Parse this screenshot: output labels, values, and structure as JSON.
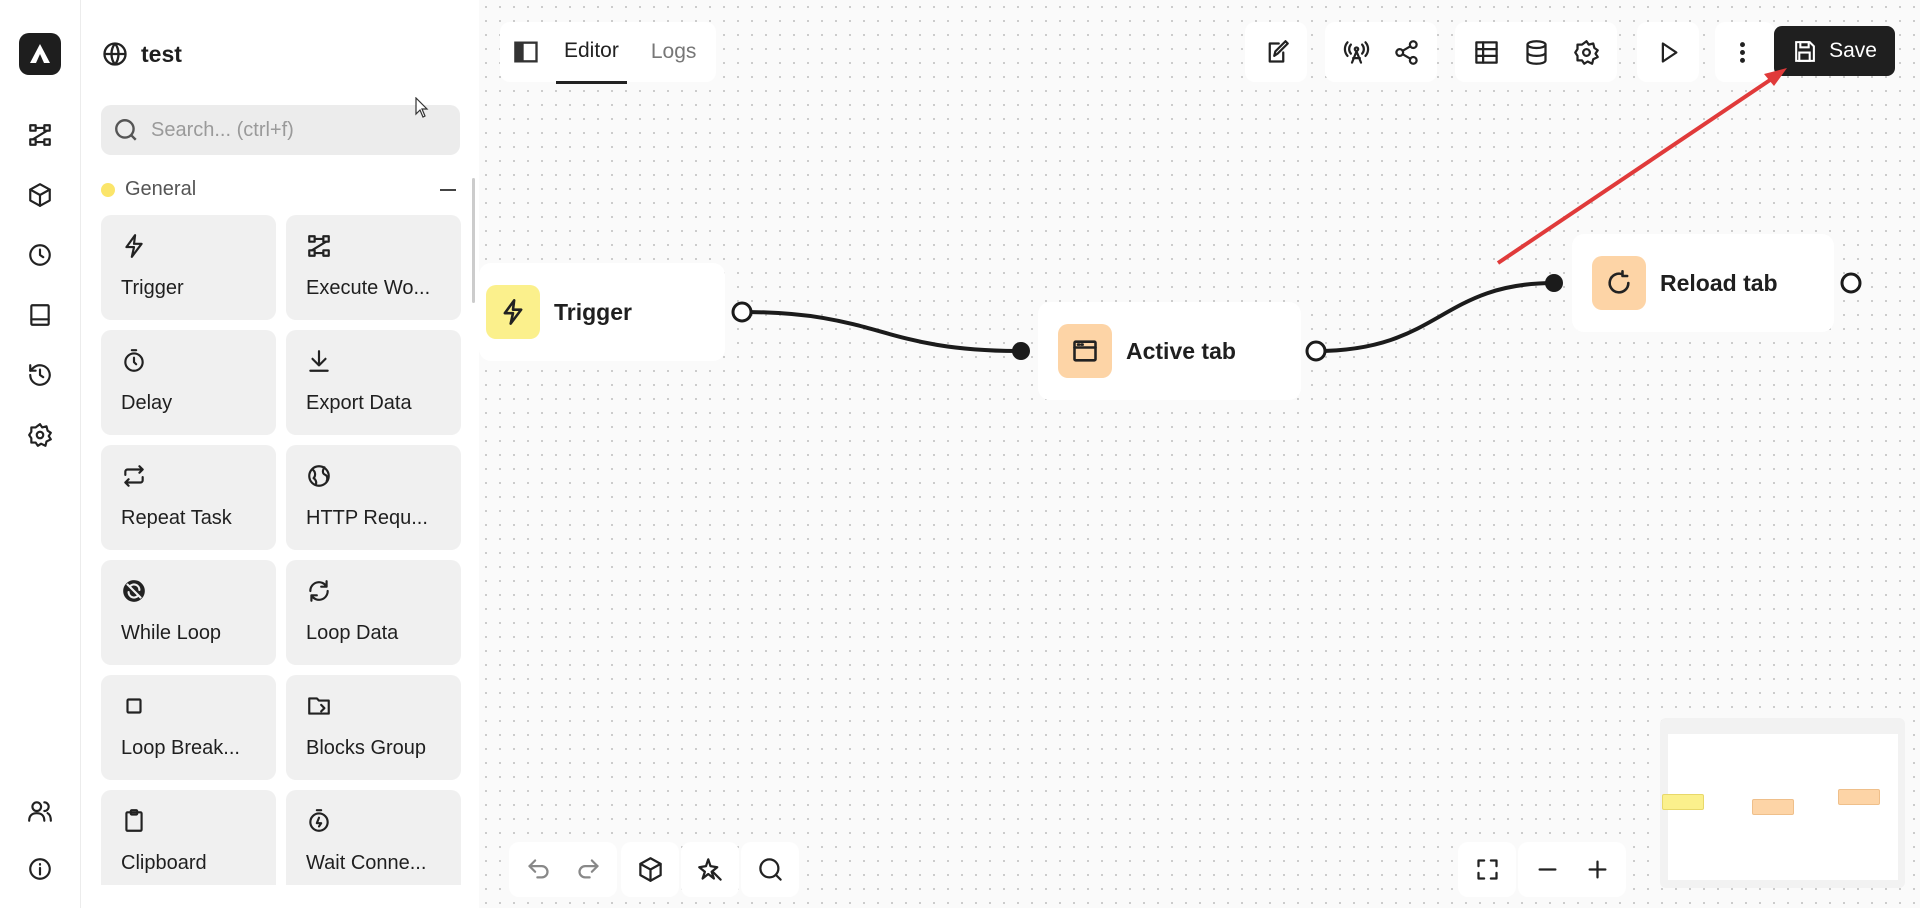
{
  "workflow": {
    "name": "test"
  },
  "search": {
    "placeholder": "Search... (ctrl+f)"
  },
  "category": {
    "name": "General",
    "color": "#fbe56a"
  },
  "blocks": [
    {
      "label": "Trigger",
      "icon": "lightning-icon"
    },
    {
      "label": "Execute Wo...",
      "icon": "workflow-icon"
    },
    {
      "label": "Delay",
      "icon": "timer-icon"
    },
    {
      "label": "Export Data",
      "icon": "download-icon"
    },
    {
      "label": "Repeat Task",
      "icon": "repeat-icon"
    },
    {
      "label": "HTTP Requ...",
      "icon": "globe-icon"
    },
    {
      "label": "While Loop",
      "icon": "loop-icon"
    },
    {
      "label": "Loop Data",
      "icon": "refresh-icon"
    },
    {
      "label": "Loop Break...",
      "icon": "stop-icon"
    },
    {
      "label": "Blocks Group",
      "icon": "folder-icon"
    },
    {
      "label": "Clipboard",
      "icon": "clipboard-icon"
    },
    {
      "label": "Wait Conne...",
      "icon": "stopwatch-icon"
    }
  ],
  "tabs": [
    {
      "label": "Editor",
      "active": true
    },
    {
      "label": "Logs",
      "active": false
    }
  ],
  "save": {
    "label": "Save"
  },
  "nodes": [
    {
      "label": "Trigger",
      "icon": "lightning-icon",
      "color": "#fbf08c"
    },
    {
      "label": "Active tab",
      "icon": "browser-window-icon",
      "color": "#fdd4a6"
    },
    {
      "label": "Reload tab",
      "icon": "reload-icon",
      "color": "#fdd4a6"
    }
  ],
  "annotation": {
    "arrow_color": "#e03a3a"
  }
}
